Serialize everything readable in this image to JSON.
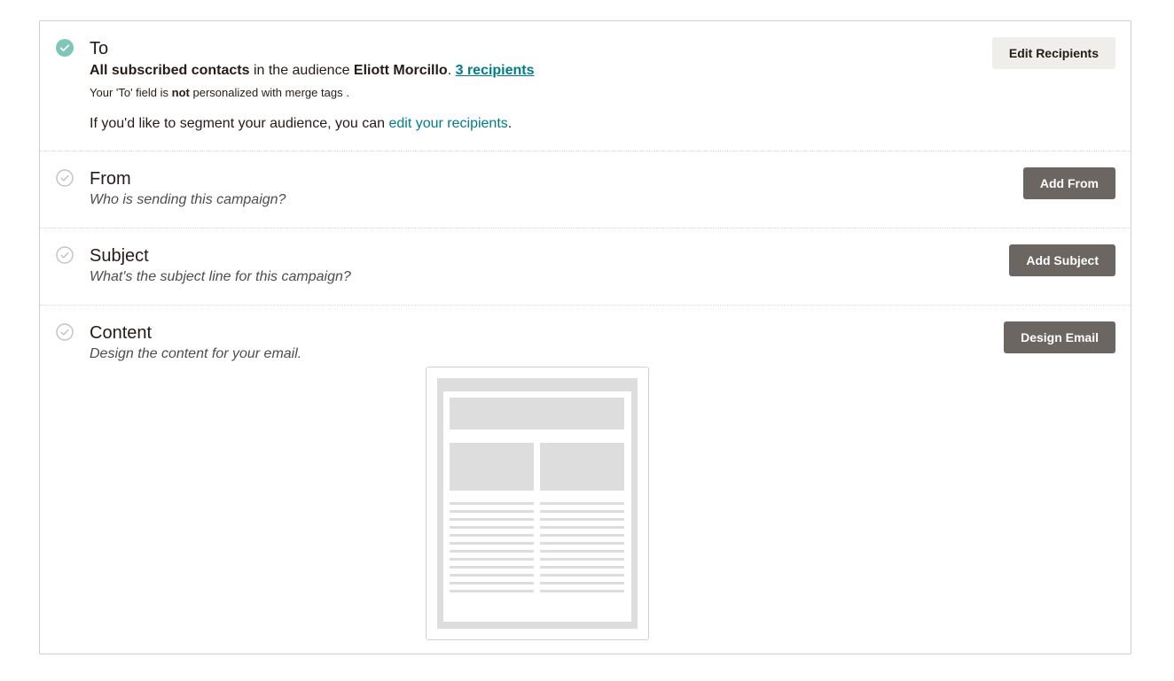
{
  "sections": {
    "to": {
      "title": "To",
      "line1_bold1": "All subscribed contacts",
      "line1_mid": " in the audience ",
      "line1_bold2": "Eliott Morcillo",
      "line1_sep": ". ",
      "recipients_link": "3 recipients",
      "line2_pre": "Your 'To' field is ",
      "line2_bold": "not",
      "line2_post": " personalized with merge tags .",
      "line3_pre": "If you'd like to segment your audience, you can ",
      "line3_link": "edit your recipients",
      "line3_post": ".",
      "button": "Edit Recipients",
      "status_icon": "check-circle-filled-icon"
    },
    "from": {
      "title": "From",
      "subtitle": "Who is sending this campaign?",
      "button": "Add From",
      "status_icon": "check-circle-outline-icon"
    },
    "subject": {
      "title": "Subject",
      "subtitle": "What's the subject line for this campaign?",
      "button": "Add Subject",
      "status_icon": "check-circle-outline-icon"
    },
    "content": {
      "title": "Content",
      "subtitle": "Design the content for your email.",
      "button": "Design Email",
      "status_icon": "check-circle-outline-icon",
      "preview_icon": "email-template-preview-icon"
    }
  },
  "colors": {
    "accent": "#007c89",
    "complete": "#7ec7b8",
    "incomplete": "#c4c4c4",
    "button_dark": "#6b6662",
    "button_light": "#efeeea"
  }
}
